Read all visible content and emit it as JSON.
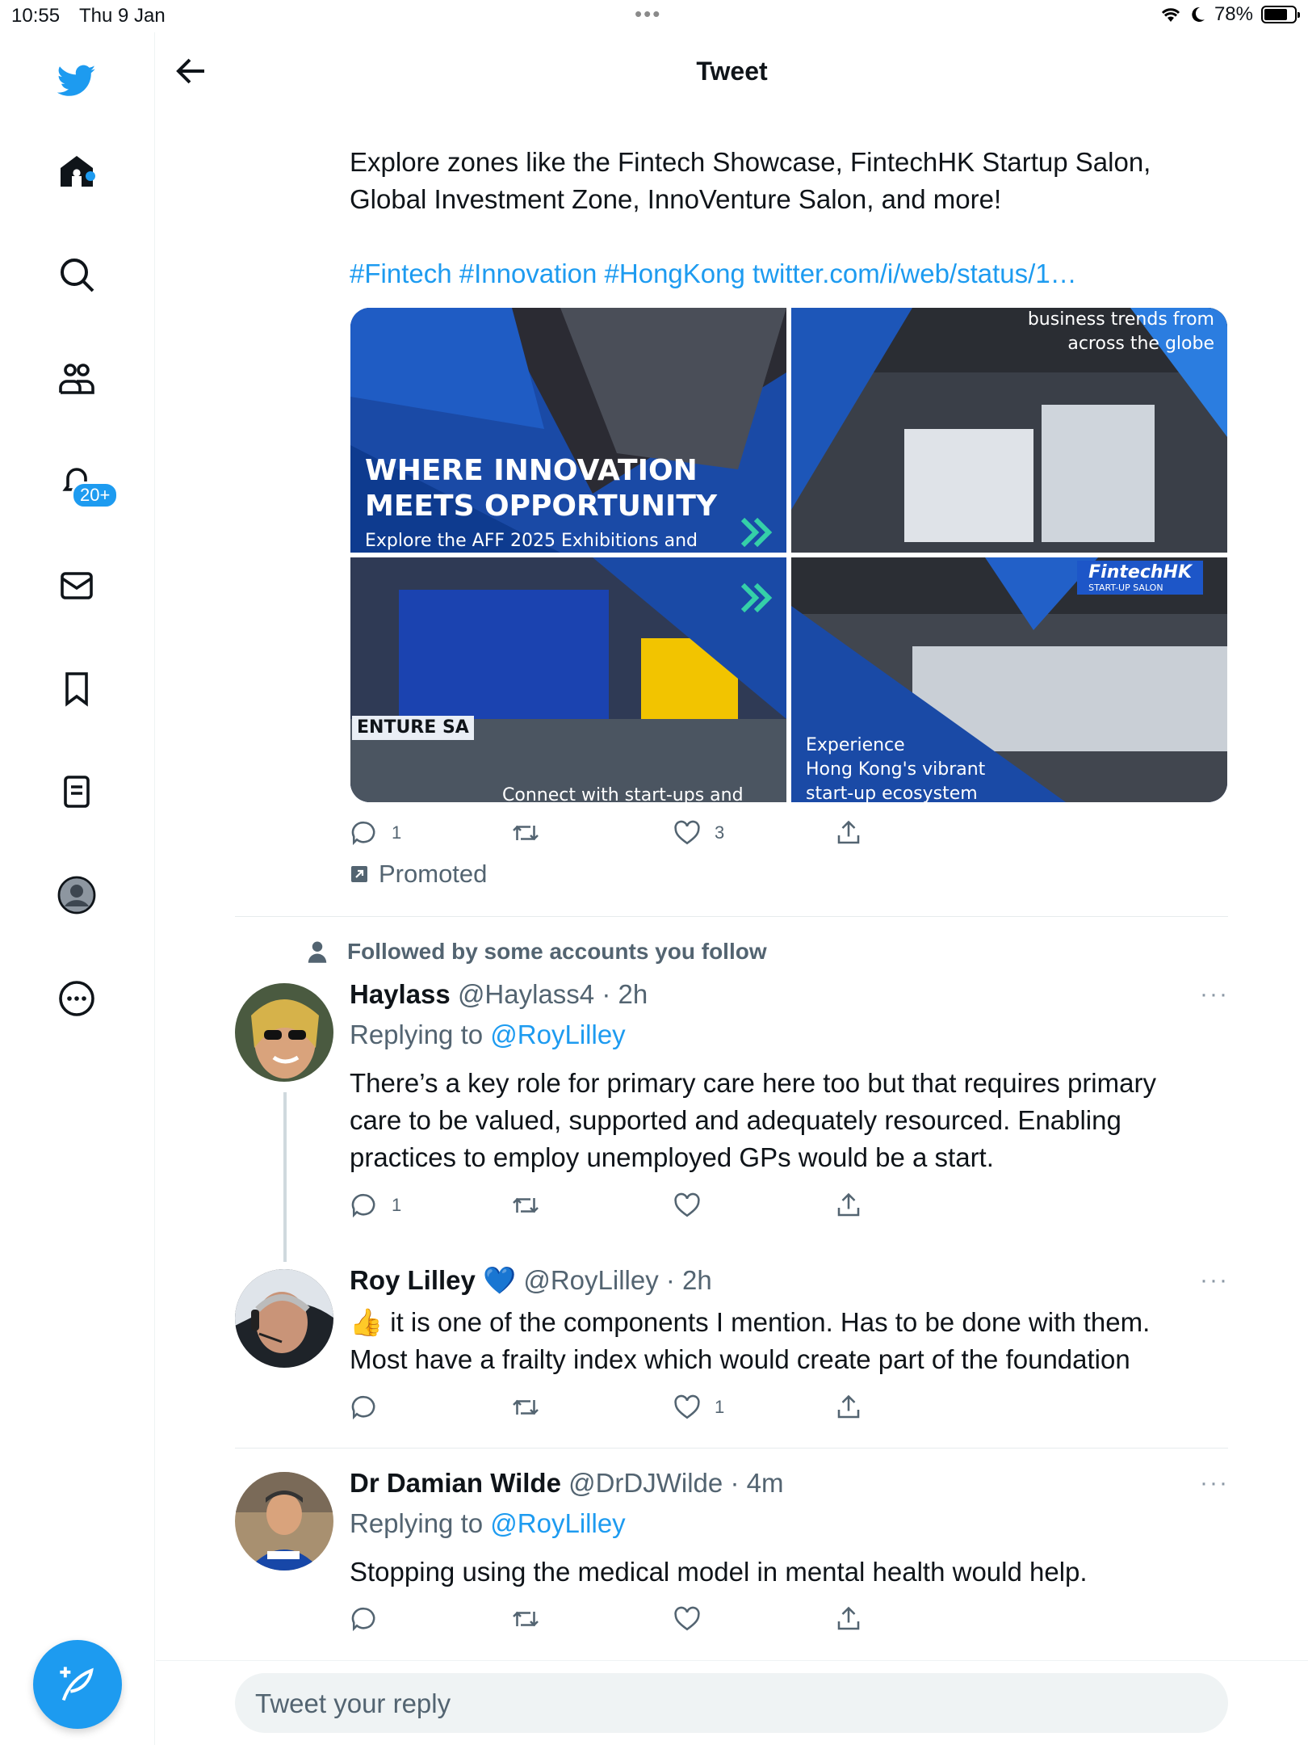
{
  "status_bar": {
    "time": "10:55",
    "date": "Thu 9 Jan",
    "battery": "78%",
    "battery_level": 0.78
  },
  "sidebar": {
    "icons": [
      "twitter-logo-icon",
      "home-icon",
      "search-icon",
      "communities-icon",
      "notifications-icon",
      "messages-icon",
      "bookmarks-icon",
      "lists-icon",
      "profile-icon",
      "more-icon"
    ],
    "notifications_badge": "20+"
  },
  "header": {
    "title": "Tweet"
  },
  "tweet": {
    "text_line1": "Explore zones like the Fintech Showcase, FintechHK Startup Salon,",
    "text_line2": "Global Investment Zone, InnoVenture Salon, and more!",
    "hashtags": "#Fintech #Innovation #HongKong twitter.com/i/web/status/1…",
    "images": {
      "tile1_title_line1": "WHERE INNOVATION",
      "tile1_title_line2": "MEETS OPPORTUNITY",
      "tile1_sub": "Explore the AFF 2025 Exhibitions and",
      "tile2_line1": "business trends from",
      "tile2_line2": "across the globe",
      "tile3_sign": "ENTURE SA",
      "tile3_sub": "Connect with start-ups and",
      "tile4_line1": "Experience",
      "tile4_line2": "Hong Kong's vibrant",
      "tile4_line3": "start-up ecosystem",
      "tile4_sign": "FintechHK",
      "tile4_sign_sub": "START-UP SALON"
    },
    "reply_count": "1",
    "like_count": "3",
    "promoted_label": "Promoted"
  },
  "social_context": "Followed by some accounts you follow",
  "replies": [
    {
      "name": "Haylass",
      "handle": "@Haylass4",
      "time": "· 2h",
      "replying_prefix": "Replying to",
      "replying_to": "@RoyLilley",
      "text_line1": "There’s a key role for primary care here too but that requires primary",
      "text_line2": "care to be valued, supported and adequately resourced.  Enabling",
      "text_line3": "practices to employ unemployed GPs would be a start.",
      "reply_count": "1",
      "like_count": ""
    },
    {
      "name": "Roy Lilley",
      "badge": "💙",
      "handle": "@RoyLilley",
      "time": "· 2h",
      "text_line1": "👍 it is one of the components I mention. Has to be done with them.",
      "text_line2": "Most have a frailty index which would create part of the foundation",
      "reply_count": "",
      "like_count": "1"
    },
    {
      "name": "Dr Damian Wilde",
      "handle": "@DrDJWilde",
      "time": "· 4m",
      "replying_prefix": "Replying to",
      "replying_to": "@RoyLilley",
      "text_line1": "Stopping using the medical model in mental health would help.",
      "reply_count": "",
      "like_count": ""
    }
  ],
  "more_menu": "···",
  "reply_input": {
    "placeholder": "Tweet your reply"
  },
  "colors": {
    "accent": "#1d9bf0",
    "text": "#0f1419",
    "secondary": "#536471"
  }
}
